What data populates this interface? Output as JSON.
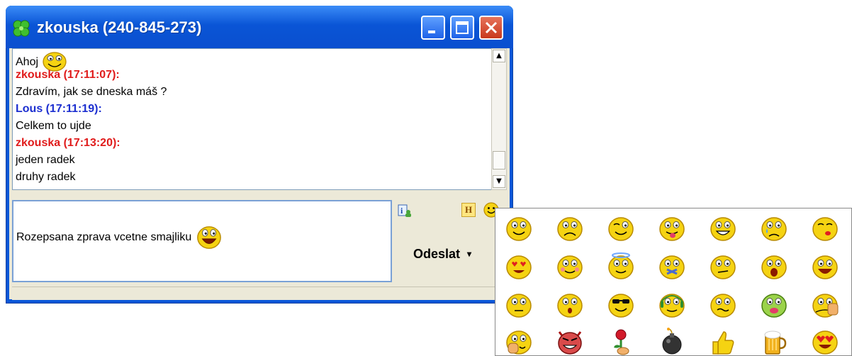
{
  "window": {
    "title": "zkouska (240-845-273)",
    "icon": "clover-icon",
    "controls": [
      "minimize-icon",
      "maximize-icon",
      "close-icon"
    ]
  },
  "chat": {
    "lines": [
      {
        "kind": "text",
        "text": "Ahoj",
        "smiley": "smile"
      },
      {
        "kind": "sender",
        "color": "red",
        "text": "zkouska (17:11:07):"
      },
      {
        "kind": "text",
        "text": "Zdravím, jak se dneska máš ?"
      },
      {
        "kind": "sender",
        "color": "blue",
        "text": "Lous (17:11:19):"
      },
      {
        "kind": "text",
        "text": "Celkem to ujde"
      },
      {
        "kind": "sender",
        "color": "red",
        "text": "zkouska (17:13:20):"
      },
      {
        "kind": "text",
        "text": "jeden radek"
      },
      {
        "kind": "text",
        "text": "druhy radek"
      }
    ]
  },
  "compose": {
    "text": "Rozepsana zprava vcetne smajliku",
    "smiley": "laugh"
  },
  "toolbar": {
    "info_icon": "contact-info-icon",
    "history_label": "H",
    "smiley_icon": "smiley-icon"
  },
  "send": {
    "label": "Odeslat",
    "arrow": "▾"
  },
  "emoticons": [
    "neutral",
    "frown",
    "wink",
    "tongue",
    "grin",
    "cry",
    "kiss",
    "love",
    "blush",
    "angel",
    "hush",
    "confused",
    "shock",
    "laugh",
    "plain",
    "surprised",
    "cool",
    "music",
    "silly",
    "sick",
    "talk-hand",
    "clap",
    "devil",
    "rose",
    "bomb",
    "thumbs-up",
    "beer",
    "heart-eyes"
  ],
  "colors": {
    "title_blue": "#0a55d6",
    "sender_red": "#e01b1b",
    "sender_blue": "#1c2fd0",
    "panel_bg": "#ece9d8",
    "smiley_yellow": "#f5d312"
  }
}
